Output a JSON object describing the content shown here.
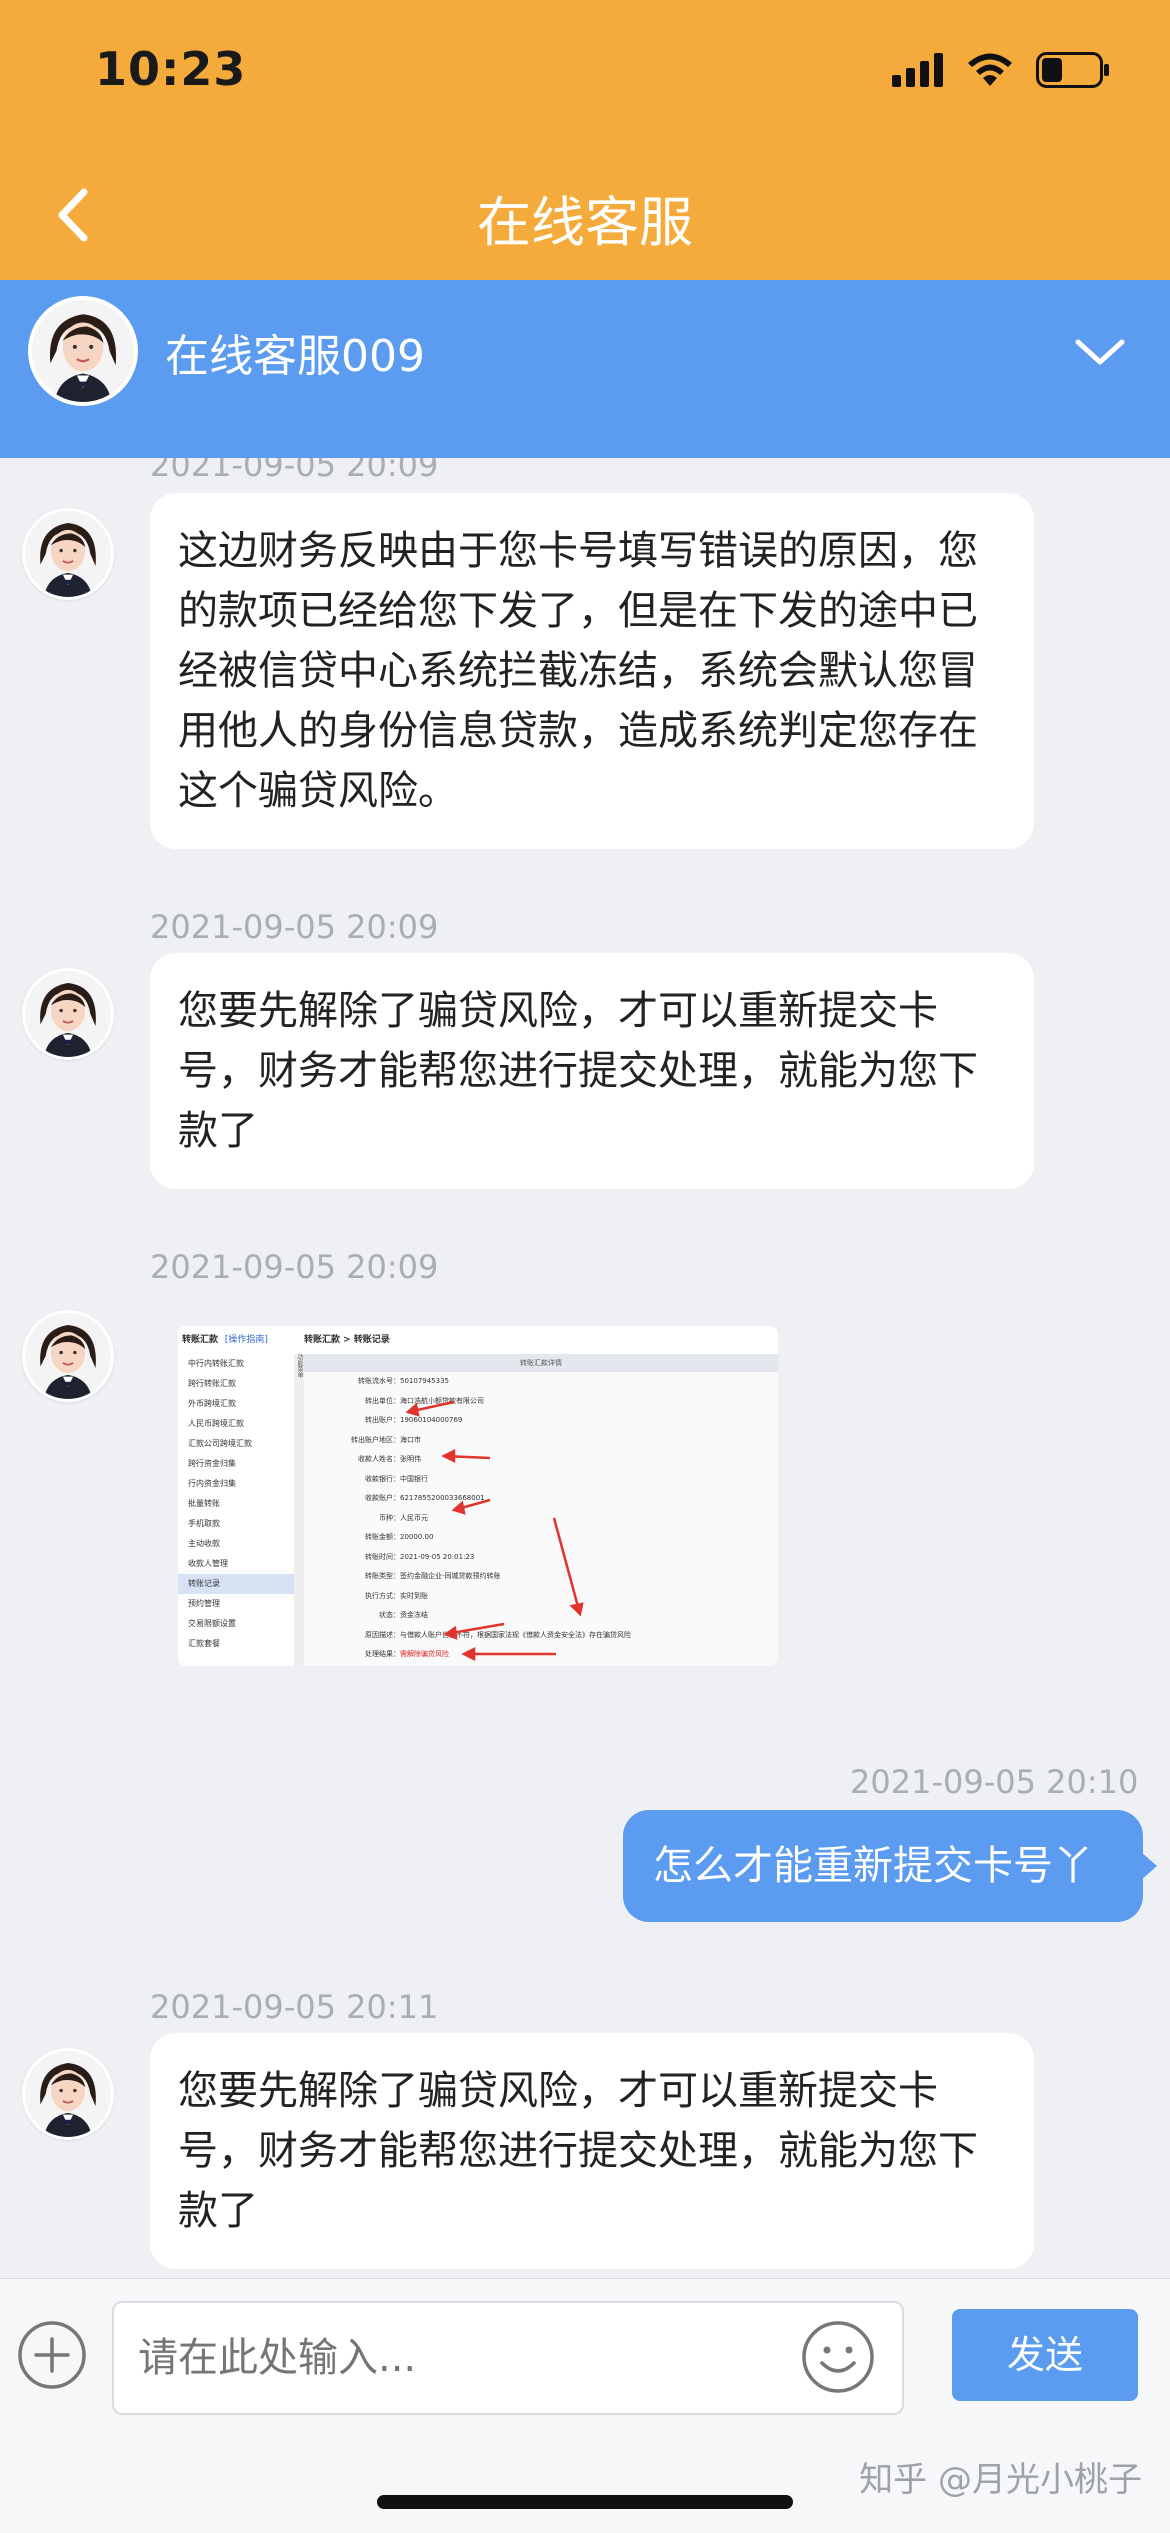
{
  "status": {
    "time": "10:23"
  },
  "nav": {
    "title": "在线客服"
  },
  "agent": {
    "name": "在线客服009"
  },
  "messages": [
    {
      "time": "2021-09-05 20:09",
      "text": "这边财务反映由于您卡号填写错误的原因，您的款项已经给您下发了，但是在下发的途中已经被信贷中心系统拦截冻结，系统会默认您冒用他人的身份信息贷款，造成系统判定您存在这个骗贷风险。"
    },
    {
      "time": "2021-09-05 20:09",
      "text": "您要先解除了骗贷风险，才可以重新提交卡号，财务才能帮您进行提交处理，就能为您下款了"
    },
    {
      "time": "2021-09-05 20:09"
    },
    {
      "time": "2021-09-05 20:10",
      "text": "怎么才能重新提交卡号丫"
    },
    {
      "time": "2021-09-05 20:11",
      "text": "您要先解除了骗贷风险，才可以重新提交卡号，财务才能帮您进行提交处理，就能为您下款了"
    }
  ],
  "screenshot": {
    "top_tab": "转账汇款",
    "top_tab_link": "[操作指南]",
    "crumb": "转账汇款 > 转账记录",
    "side_label": "功能菜单",
    "heading": "转账汇款详情",
    "menu": [
      "中行内转账汇款",
      "跨行转账汇款",
      "外币跨境汇款",
      "人民币跨境汇款",
      "汇款公司跨境汇款",
      "跨行资金归集",
      "行内资金归集",
      "批量转账",
      "手机取款",
      "主动收款",
      "收款人管理",
      "转账记录",
      "预约管理",
      "交易限额设置",
      "汇款套餐"
    ],
    "rows": [
      {
        "k": "转账流水号：",
        "v": "50107945335"
      },
      {
        "k": "转出单位：",
        "v": "海口浩航小额贷款有限公司"
      },
      {
        "k": "转出账户：",
        "v": "19060104000769"
      },
      {
        "k": "转出账户地区：",
        "v": "海口市"
      },
      {
        "k": "收款人姓名：",
        "v": "张明伟"
      },
      {
        "k": "收款银行：",
        "v": "中国银行"
      },
      {
        "k": "收款账户：",
        "v": "6217855200033668001"
      },
      {
        "k": "币种：",
        "v": "人民币元"
      },
      {
        "k": "转账金额：",
        "v": "20000.00"
      },
      {
        "k": "转账时间：",
        "v": "2021-09-05 20:01:23"
      },
      {
        "k": "转账类型：",
        "v": "签约金融企业-同城贷款预约转账"
      },
      {
        "k": "执行方式：",
        "v": "实时到账"
      },
      {
        "k": "状态：",
        "v": "资金冻结"
      },
      {
        "k": "原因描述：",
        "v": "与借款人账户信息不符，根据国家法规《借款人资金安全法》存在骗贷风险"
      },
      {
        "k": "处理结果：",
        "v": "需解除骗贷风险"
      }
    ]
  },
  "input": {
    "placeholder": "请在此处输入...",
    "send_label": "发送"
  },
  "watermark": "知乎 @月光小桃子",
  "colors": {
    "header_orange": "#f5ab3c",
    "accent_blue": "#5b9bf0",
    "chat_bg": "#eef0f4"
  }
}
